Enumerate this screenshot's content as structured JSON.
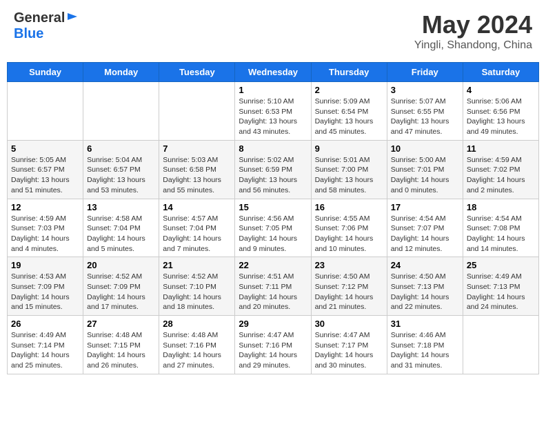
{
  "logo": {
    "general": "General",
    "blue": "Blue"
  },
  "header": {
    "month": "May 2024",
    "location": "Yingli, Shandong, China"
  },
  "weekdays": [
    "Sunday",
    "Monday",
    "Tuesday",
    "Wednesday",
    "Thursday",
    "Friday",
    "Saturday"
  ],
  "weeks": [
    [
      {
        "day": "",
        "info": ""
      },
      {
        "day": "",
        "info": ""
      },
      {
        "day": "",
        "info": ""
      },
      {
        "day": "1",
        "info": "Sunrise: 5:10 AM\nSunset: 6:53 PM\nDaylight: 13 hours\nand 43 minutes."
      },
      {
        "day": "2",
        "info": "Sunrise: 5:09 AM\nSunset: 6:54 PM\nDaylight: 13 hours\nand 45 minutes."
      },
      {
        "day": "3",
        "info": "Sunrise: 5:07 AM\nSunset: 6:55 PM\nDaylight: 13 hours\nand 47 minutes."
      },
      {
        "day": "4",
        "info": "Sunrise: 5:06 AM\nSunset: 6:56 PM\nDaylight: 13 hours\nand 49 minutes."
      }
    ],
    [
      {
        "day": "5",
        "info": "Sunrise: 5:05 AM\nSunset: 6:57 PM\nDaylight: 13 hours\nand 51 minutes."
      },
      {
        "day": "6",
        "info": "Sunrise: 5:04 AM\nSunset: 6:57 PM\nDaylight: 13 hours\nand 53 minutes."
      },
      {
        "day": "7",
        "info": "Sunrise: 5:03 AM\nSunset: 6:58 PM\nDaylight: 13 hours\nand 55 minutes."
      },
      {
        "day": "8",
        "info": "Sunrise: 5:02 AM\nSunset: 6:59 PM\nDaylight: 13 hours\nand 56 minutes."
      },
      {
        "day": "9",
        "info": "Sunrise: 5:01 AM\nSunset: 7:00 PM\nDaylight: 13 hours\nand 58 minutes."
      },
      {
        "day": "10",
        "info": "Sunrise: 5:00 AM\nSunset: 7:01 PM\nDaylight: 14 hours\nand 0 minutes."
      },
      {
        "day": "11",
        "info": "Sunrise: 4:59 AM\nSunset: 7:02 PM\nDaylight: 14 hours\nand 2 minutes."
      }
    ],
    [
      {
        "day": "12",
        "info": "Sunrise: 4:59 AM\nSunset: 7:03 PM\nDaylight: 14 hours\nand 4 minutes."
      },
      {
        "day": "13",
        "info": "Sunrise: 4:58 AM\nSunset: 7:04 PM\nDaylight: 14 hours\nand 5 minutes."
      },
      {
        "day": "14",
        "info": "Sunrise: 4:57 AM\nSunset: 7:04 PM\nDaylight: 14 hours\nand 7 minutes."
      },
      {
        "day": "15",
        "info": "Sunrise: 4:56 AM\nSunset: 7:05 PM\nDaylight: 14 hours\nand 9 minutes."
      },
      {
        "day": "16",
        "info": "Sunrise: 4:55 AM\nSunset: 7:06 PM\nDaylight: 14 hours\nand 10 minutes."
      },
      {
        "day": "17",
        "info": "Sunrise: 4:54 AM\nSunset: 7:07 PM\nDaylight: 14 hours\nand 12 minutes."
      },
      {
        "day": "18",
        "info": "Sunrise: 4:54 AM\nSunset: 7:08 PM\nDaylight: 14 hours\nand 14 minutes."
      }
    ],
    [
      {
        "day": "19",
        "info": "Sunrise: 4:53 AM\nSunset: 7:09 PM\nDaylight: 14 hours\nand 15 minutes."
      },
      {
        "day": "20",
        "info": "Sunrise: 4:52 AM\nSunset: 7:09 PM\nDaylight: 14 hours\nand 17 minutes."
      },
      {
        "day": "21",
        "info": "Sunrise: 4:52 AM\nSunset: 7:10 PM\nDaylight: 14 hours\nand 18 minutes."
      },
      {
        "day": "22",
        "info": "Sunrise: 4:51 AM\nSunset: 7:11 PM\nDaylight: 14 hours\nand 20 minutes."
      },
      {
        "day": "23",
        "info": "Sunrise: 4:50 AM\nSunset: 7:12 PM\nDaylight: 14 hours\nand 21 minutes."
      },
      {
        "day": "24",
        "info": "Sunrise: 4:50 AM\nSunset: 7:13 PM\nDaylight: 14 hours\nand 22 minutes."
      },
      {
        "day": "25",
        "info": "Sunrise: 4:49 AM\nSunset: 7:13 PM\nDaylight: 14 hours\nand 24 minutes."
      }
    ],
    [
      {
        "day": "26",
        "info": "Sunrise: 4:49 AM\nSunset: 7:14 PM\nDaylight: 14 hours\nand 25 minutes."
      },
      {
        "day": "27",
        "info": "Sunrise: 4:48 AM\nSunset: 7:15 PM\nDaylight: 14 hours\nand 26 minutes."
      },
      {
        "day": "28",
        "info": "Sunrise: 4:48 AM\nSunset: 7:16 PM\nDaylight: 14 hours\nand 27 minutes."
      },
      {
        "day": "29",
        "info": "Sunrise: 4:47 AM\nSunset: 7:16 PM\nDaylight: 14 hours\nand 29 minutes."
      },
      {
        "day": "30",
        "info": "Sunrise: 4:47 AM\nSunset: 7:17 PM\nDaylight: 14 hours\nand 30 minutes."
      },
      {
        "day": "31",
        "info": "Sunrise: 4:46 AM\nSunset: 7:18 PM\nDaylight: 14 hours\nand 31 minutes."
      },
      {
        "day": "",
        "info": ""
      }
    ]
  ]
}
